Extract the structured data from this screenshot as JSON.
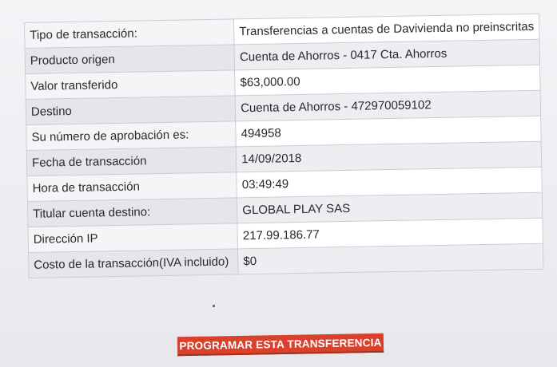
{
  "receipt": {
    "rows": [
      {
        "label": "Tipo de transacción:",
        "value": "Transferencias a cuentas de Davivienda no preinscritas"
      },
      {
        "label": "Producto origen",
        "value": "Cuenta de Ahorros - 0417 Cta. Ahorros"
      },
      {
        "label": "Valor transferido",
        "value": "$63,000.00"
      },
      {
        "label": "Destino",
        "value": "Cuenta de Ahorros - 472970059102"
      },
      {
        "label": "Su número de aprobación es:",
        "value": "494958"
      },
      {
        "label": "Fecha de transacción",
        "value": "14/09/2018"
      },
      {
        "label": "Hora de transacción",
        "value": "03:49:49"
      },
      {
        "label": "Titular cuenta destino:",
        "value": "GLOBAL PLAY SAS"
      },
      {
        "label": "Dirección IP",
        "value": "217.99.186.77"
      },
      {
        "label": "Costo de la transacción(IVA incluido)",
        "value": "$0"
      }
    ]
  },
  "actions": {
    "schedule_label": "PROGRAMAR ESTA TRANSFERENCIA",
    "button_color": "#d9412c"
  }
}
